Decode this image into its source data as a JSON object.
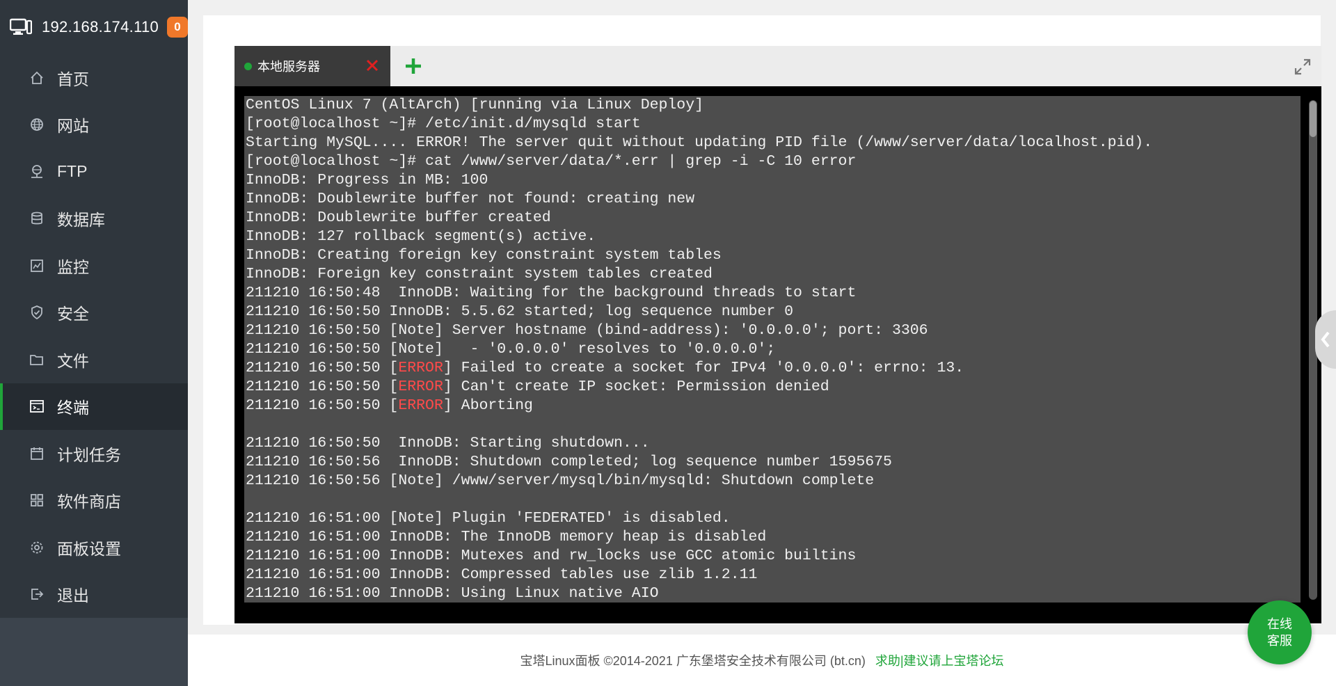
{
  "server": {
    "ip": "192.168.174.110",
    "alert_count": "0"
  },
  "sidebar": {
    "items": [
      {
        "label": "首页",
        "icon": "home-icon"
      },
      {
        "label": "网站",
        "icon": "globe-icon"
      },
      {
        "label": "FTP",
        "icon": "ftp-icon"
      },
      {
        "label": "数据库",
        "icon": "database-icon"
      },
      {
        "label": "监控",
        "icon": "monitor-icon"
      },
      {
        "label": "安全",
        "icon": "shield-icon"
      },
      {
        "label": "文件",
        "icon": "folder-icon"
      },
      {
        "label": "终端",
        "icon": "terminal-icon",
        "active": true
      },
      {
        "label": "计划任务",
        "icon": "calendar-icon"
      },
      {
        "label": "软件商店",
        "icon": "apps-icon"
      },
      {
        "label": "面板设置",
        "icon": "gear-icon"
      },
      {
        "label": "退出",
        "icon": "logout-icon"
      }
    ]
  },
  "terminal": {
    "tab_label": "本地服务器",
    "lines": [
      "CentOS Linux 7 (AltArch) [running via Linux Deploy]",
      "[root@localhost ~]# /etc/init.d/mysqld start",
      "Starting MySQL.... ERROR! The server quit without updating PID file (/www/server/data/localhost.pid).",
      "[root@localhost ~]# cat /www/server/data/*.err | grep -i -C 10 error",
      "InnoDB: Progress in MB: 100",
      "InnoDB: Doublewrite buffer not found: creating new",
      "InnoDB: Doublewrite buffer created",
      "InnoDB: 127 rollback segment(s) active.",
      "InnoDB: Creating foreign key constraint system tables",
      "InnoDB: Foreign key constraint system tables created",
      "211210 16:50:48  InnoDB: Waiting for the background threads to start",
      "211210 16:50:50 InnoDB: 5.5.62 started; log sequence number 0",
      "211210 16:50:50 [Note] Server hostname (bind-address): '0.0.0.0'; port: 3306",
      "211210 16:50:50 [Note]   - '0.0.0.0' resolves to '0.0.0.0';",
      "211210 16:50:50 [ERROR] Failed to create a socket for IPv4 '0.0.0.0': errno: 13.",
      "211210 16:50:50 [ERROR] Can't create IP socket: Permission denied",
      "211210 16:50:50 [ERROR] Aborting",
      "",
      "211210 16:50:50  InnoDB: Starting shutdown...",
      "211210 16:50:56  InnoDB: Shutdown completed; log sequence number 1595675",
      "211210 16:50:56 [Note] /www/server/mysql/bin/mysqld: Shutdown complete",
      "",
      "211210 16:51:00 [Note] Plugin 'FEDERATED' is disabled.",
      "211210 16:51:00 InnoDB: The InnoDB memory heap is disabled",
      "211210 16:51:00 InnoDB: Mutexes and rw_locks use GCC atomic builtins",
      "211210 16:51:00 InnoDB: Compressed tables use zlib 1.2.11",
      "211210 16:51:00 InnoDB: Using Linux native AIO"
    ]
  },
  "footer": {
    "copyright": "宝塔Linux面板 ©2014-2021 广东堡塔安全技术有限公司 (bt.cn)",
    "help_link": "求助|建议请上宝塔论坛"
  },
  "chat": {
    "label_line1": "在线",
    "label_line2": "客服"
  },
  "colors": {
    "accent": "#20a53a",
    "sidebar_bg": "#3c444d",
    "badge": "#f0782a",
    "error": "#ff4a4a"
  }
}
